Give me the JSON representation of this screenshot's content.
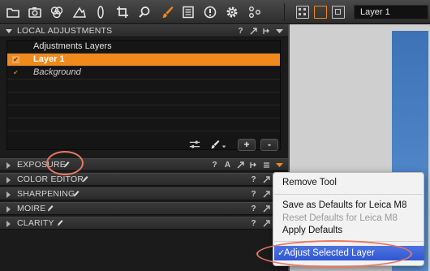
{
  "toolbar": {
    "icons": [
      "folder-icon",
      "camera-icon",
      "color-circles-icon",
      "triangle-icon",
      "exposure-icon",
      "crop-icon",
      "search-icon",
      "brush-icon",
      "metadata-icon",
      "info-icon",
      "gear-icon",
      "batch-icon"
    ],
    "active_icon": "brush-icon",
    "view_buttons": [
      "grid-view-icon",
      "single-view-icon",
      "fullscreen-view-icon"
    ],
    "layer_selector": "Layer 1"
  },
  "local_adjustments": {
    "title": "LOCAL ADJUSTMENTS",
    "list_header": "Adjustments Layers",
    "layers": [
      {
        "name": "Layer 1",
        "selected": true,
        "checked": true
      },
      {
        "name": "Background",
        "selected": false,
        "checked": true
      }
    ],
    "buttons": {
      "add": "+",
      "remove": "-"
    }
  },
  "header_icons": {
    "help": "?",
    "auto": "A"
  },
  "tools": [
    {
      "title": "EXPOSURE"
    },
    {
      "title": "COLOR EDITOR"
    },
    {
      "title": "SHARPENING"
    },
    {
      "title": "MOIRE"
    },
    {
      "title": "CLARITY"
    }
  ],
  "context_menu": {
    "remove_tool": "Remove Tool",
    "save_defaults": "Save as Defaults for Leica M8",
    "reset_defaults": "Reset Defaults for Leica M8",
    "apply_defaults": "Apply Defaults",
    "adjust_selected": "Adjust Selected Layer",
    "check": "✓"
  },
  "colors": {
    "accent": "#f08a1c",
    "menu_highlight": "#3a62d8",
    "annotation": "#e87860"
  }
}
